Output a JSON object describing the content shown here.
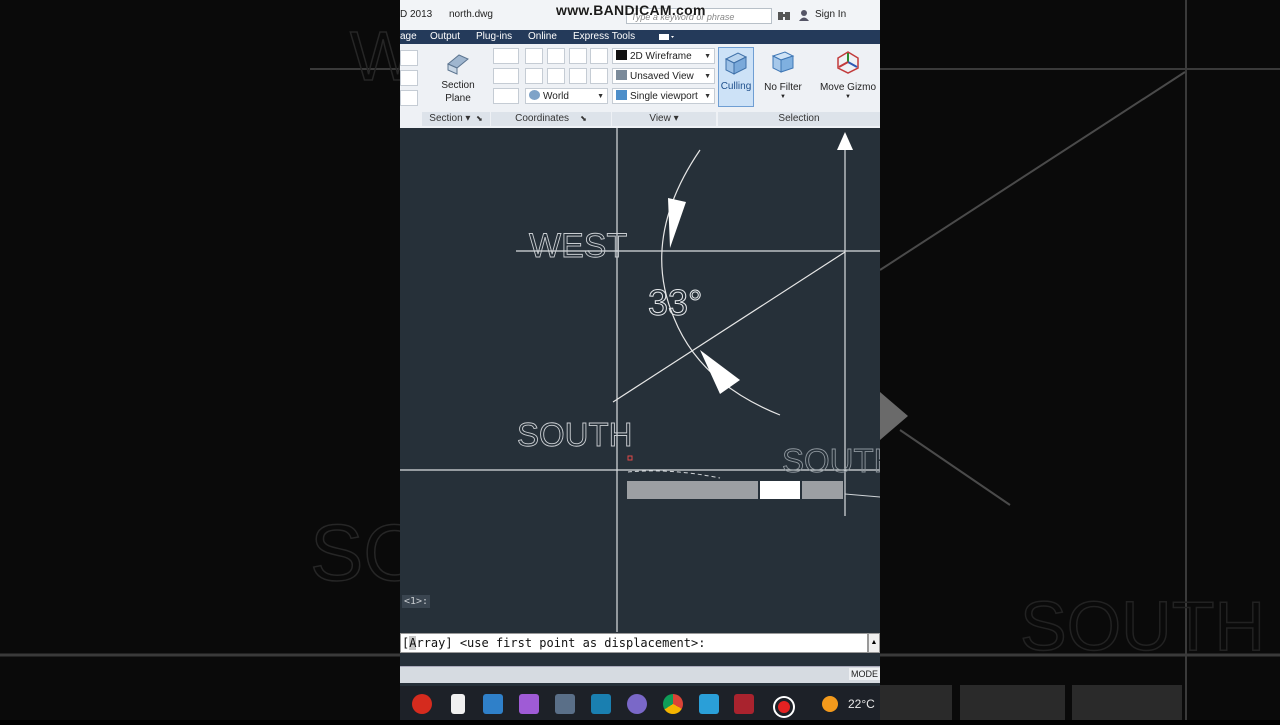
{
  "titlebar": {
    "app_title_fragment": "D 2013",
    "file_name": "north.dwg",
    "search_placeholder": "Type a keyword or phrase",
    "sign_in": "Sign In",
    "watermark": "www.BANDICAM.com"
  },
  "menu": {
    "items": [
      "age",
      "Output",
      "Plug-ins",
      "Online",
      "Express Tools"
    ]
  },
  "ribbon": {
    "section_plane": {
      "line1": "Section",
      "line2": "Plane"
    },
    "panels": {
      "section": "Section",
      "coordinates": "Coordinates",
      "view": "View",
      "selection": "Selection"
    },
    "coords_combo": "World",
    "view_combos": [
      "2D Wireframe",
      "Unsaved View",
      "Single viewport"
    ],
    "culling": "Culling",
    "no_filter": "No Filter",
    "move_gizmo": "Move Gizmo"
  },
  "drawing": {
    "labels": {
      "west": "WEST",
      "south_left": "SOUTH",
      "south_right": "SOUTH",
      "angle": "33°"
    }
  },
  "viewport_label": "<1>:",
  "command": {
    "bracket_open": "[",
    "highlight": "A",
    "rest": "rray] <use first point as displacement>:"
  },
  "status": {
    "mode": "MODE"
  },
  "taskbar": {
    "temperature": "22°C"
  },
  "colors": {
    "viewport_bg": "#263039",
    "menubar": "#243a5a",
    "ribbon_bg": "#eef1f5",
    "drawing_line": "#e6e6e6",
    "taskbar": "#1d2128"
  }
}
